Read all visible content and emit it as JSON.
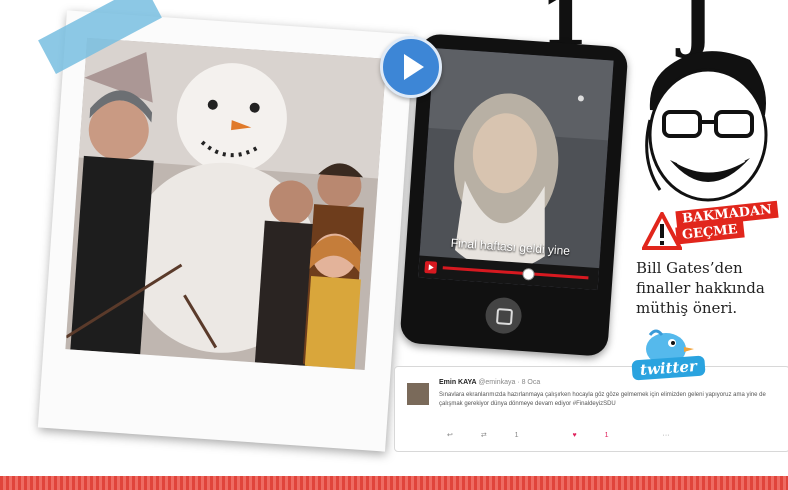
{
  "header_glyphs": [
    "1",
    "J"
  ],
  "video": {
    "caption": "Final haftası geldi yine"
  },
  "badge": {
    "line1": "BAKMADAN",
    "line2": "GEÇME"
  },
  "blurb": "Bill Gates’den finaller hakkında müthiş öneri.",
  "tweet": {
    "name": "Emin KAYA",
    "handle": "@eminkaya · 8 Oca",
    "text": "Sınavlara ekranlarımızda hazırlanmaya çalışırken hocayla göz göze gelmemek için elimizden geleni yapıyoruz ama yine de çalışmak gerekiyor dünya dönmeye devam ediyor #FinaldeyizSDU",
    "retweets": "1",
    "likes": "1"
  },
  "twitter_label": "twitter",
  "colors": {
    "accent_red": "#e1261c",
    "play_blue": "#3d86d6",
    "tape_blue": "#78bee1",
    "twitter_blue": "#2aa3df"
  }
}
